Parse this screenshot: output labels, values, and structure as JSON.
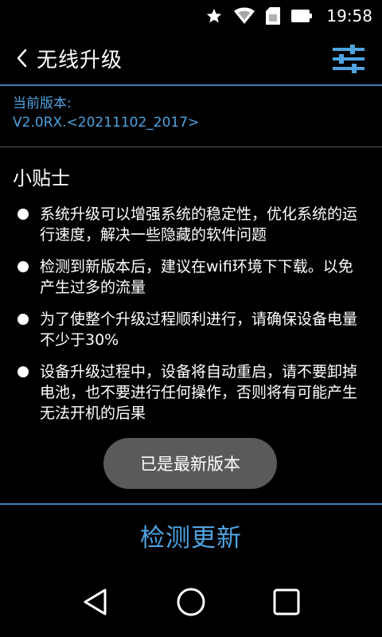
{
  "status_bar": {
    "time": "19:58",
    "icons": [
      "star-icon",
      "wifi-icon",
      "sim-card-icon",
      "battery-icon"
    ]
  },
  "header": {
    "title": "无线升级",
    "back_icon": "chevron-left-icon",
    "settings_icon": "sliders-icon"
  },
  "version": {
    "label": "当前版本:",
    "value": "V2.0RX.<20211102_2017>"
  },
  "tips": {
    "title": "小贴士",
    "items": [
      "系统升级可以增强系统的稳定性，优化系统的运行速度，解决一些隐藏的软件问题",
      "检测到新版本后，建议在wifi环境下下载。以免产生过多的流量",
      "为了使整个升级过程顺利进行，请确保设备电量不少于30%",
      "设备升级过程中，设备将自动重启，请不要卸掉电池，也不要进行任何操作，否则将有可能产生无法开机的后果"
    ]
  },
  "toast": {
    "text": "已是最新版本"
  },
  "actions": {
    "check_update_label": "检测更新"
  },
  "nav_bar": {
    "icons": [
      "back-triangle-icon",
      "home-circle-icon",
      "recents-square-icon"
    ]
  },
  "colors": {
    "accent": "#4fa3e0",
    "divider_accent": "#3d7fb8",
    "background": "#000000",
    "toast_bg": "#5a5a5a"
  }
}
